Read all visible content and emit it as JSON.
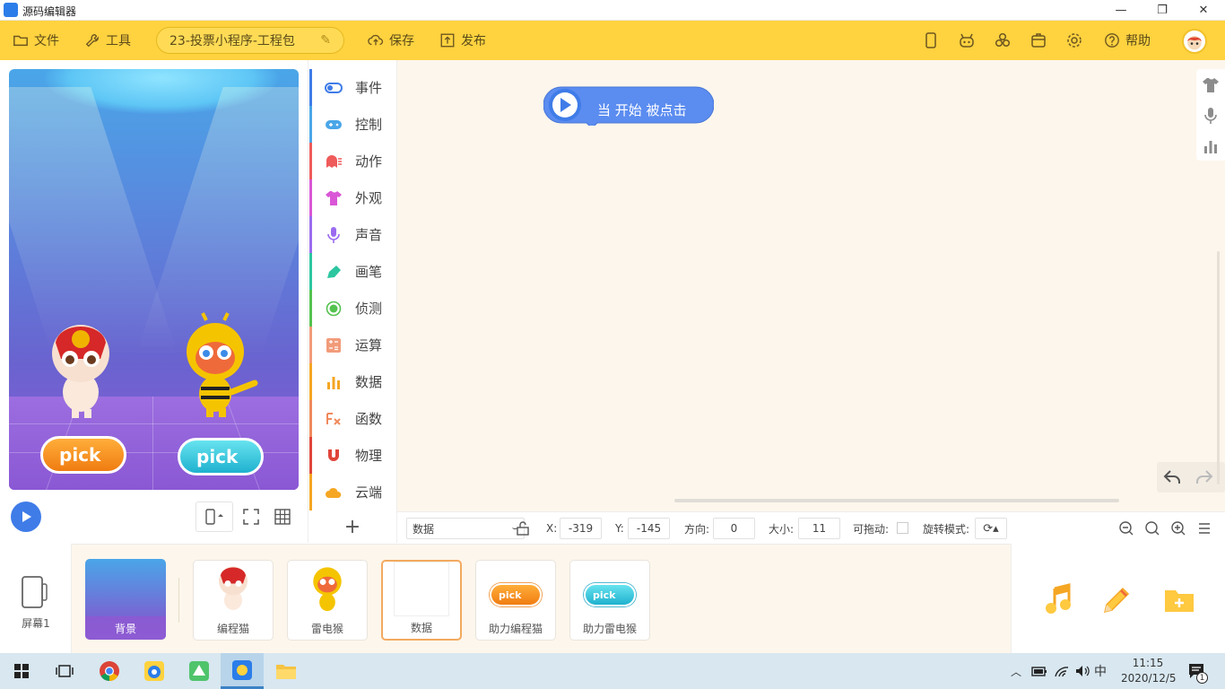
{
  "window": {
    "title": "源码编辑器",
    "controls": {
      "minimize": "—",
      "restore": "❐",
      "close": "✕"
    }
  },
  "toolbar": {
    "file": "文件",
    "tools": "工具",
    "project_name": "23-投票小程序-工程包",
    "save": "保存",
    "publish": "发布",
    "help": "帮助"
  },
  "stage": {
    "sprites": [
      {
        "label": "pick"
      },
      {
        "label": "pick"
      }
    ]
  },
  "categories": [
    {
      "label": "事件",
      "color": "#3f7ce8",
      "icon": "toggle-icon"
    },
    {
      "label": "控制",
      "color": "#4aa6e8",
      "icon": "gamepad-icon"
    },
    {
      "label": "动作",
      "color": "#ef5b5b",
      "icon": "ghost-icon"
    },
    {
      "label": "外观",
      "color": "#d956d6",
      "icon": "shirt-icon"
    },
    {
      "label": "声音",
      "color": "#9b6cf0",
      "icon": "microphone-icon"
    },
    {
      "label": "画笔",
      "color": "#2cc6a0",
      "icon": "pen-icon"
    },
    {
      "label": "侦测",
      "color": "#54c24f",
      "icon": "target-icon"
    },
    {
      "label": "运算",
      "color": "#f29b7a",
      "icon": "calculator-icon"
    },
    {
      "label": "数据",
      "color": "#f5a623",
      "icon": "bar-chart-icon"
    },
    {
      "label": "函数",
      "color": "#f08a5d",
      "icon": "function-icon"
    },
    {
      "label": "物理",
      "color": "#e0453a",
      "icon": "magnet-icon"
    },
    {
      "label": "云端",
      "color": "#f5a623",
      "icon": "cloud-icon"
    }
  ],
  "add_category": "+",
  "workspace": {
    "hat_block": "当 开始 被点击"
  },
  "props": {
    "sprite_name": "数据",
    "x_label": "X:",
    "x": "-319",
    "y_label": "Y:",
    "y": "-145",
    "dir_label": "方向:",
    "dir": "0",
    "size_label": "大小:",
    "size": "11",
    "drag_label": "可拖动:",
    "rotate_label": "旋转模式:"
  },
  "spritebar": {
    "screen_label": "屏幕1",
    "background": "背景",
    "sprites": [
      "编程猫",
      "雷电猴",
      "数据",
      "助力编程猫",
      "助力雷电猴"
    ]
  },
  "taskbar": {
    "time": "11:15",
    "date": "2020/12/5",
    "ime": "中",
    "notification_count": "1"
  }
}
